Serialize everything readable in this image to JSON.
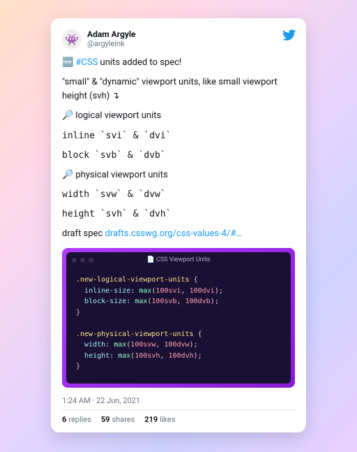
{
  "author": {
    "display_name": "Adam Argyle",
    "handle": "@argyleink",
    "avatar_emoji": "👾"
  },
  "tweet": {
    "line_new_emoji": "🆕",
    "hashtag": "#CSS",
    "line_new_rest": " units added to spec!",
    "line_intro": "\"small\" & \"dynamic\" viewport units, like small viewport height (svh) ↴",
    "section_logical": "🔎 logical viewport units",
    "line_logical_inline": "inline `svi` & `dvi`",
    "line_logical_block": "block `svb` & `dvb`",
    "section_physical": "🔎 physical viewport units",
    "line_physical_width": "width `svw` & `dvw`",
    "line_physical_height": "height `svh` & `dvh`",
    "draft_label": "draft spec ",
    "draft_link": "drafts.csswg.org/css-values-4/#…"
  },
  "code_window": {
    "title": "📄 CSS Viewport Units",
    "code_tokens": [
      [
        [
          "sel",
          ".new-logical-viewport-units"
        ],
        [
          "punct",
          " {"
        ]
      ],
      [
        [
          "punct",
          "  "
        ],
        [
          "prop",
          "inline-size"
        ],
        [
          "punct",
          ": "
        ],
        [
          "func",
          "max"
        ],
        [
          "punct",
          "("
        ],
        [
          "unit",
          "100svi"
        ],
        [
          "punct",
          ", "
        ],
        [
          "unit",
          "100dvi"
        ],
        [
          "punct",
          ");"
        ]
      ],
      [
        [
          "punct",
          "  "
        ],
        [
          "prop",
          "block-size"
        ],
        [
          "punct",
          ": "
        ],
        [
          "func",
          "max"
        ],
        [
          "punct",
          "("
        ],
        [
          "unit",
          "100svb"
        ],
        [
          "punct",
          ", "
        ],
        [
          "unit",
          "100dvb"
        ],
        [
          "punct",
          ");"
        ]
      ],
      [
        [
          "punct",
          "}"
        ]
      ],
      [
        [
          "punct",
          ""
        ]
      ],
      [
        [
          "sel",
          ".new-physical-viewport-units"
        ],
        [
          "punct",
          " {"
        ]
      ],
      [
        [
          "punct",
          "  "
        ],
        [
          "prop",
          "width"
        ],
        [
          "punct",
          ": "
        ],
        [
          "func",
          "max"
        ],
        [
          "punct",
          "("
        ],
        [
          "unit",
          "100svw"
        ],
        [
          "punct",
          ", "
        ],
        [
          "unit",
          "100dvw"
        ],
        [
          "punct",
          ");"
        ]
      ],
      [
        [
          "punct",
          "  "
        ],
        [
          "prop",
          "height"
        ],
        [
          "punct",
          ": "
        ],
        [
          "func",
          "max"
        ],
        [
          "punct",
          "("
        ],
        [
          "unit",
          "100svh"
        ],
        [
          "punct",
          ", "
        ],
        [
          "unit",
          "100dvh"
        ],
        [
          "punct",
          ");"
        ]
      ],
      [
        [
          "punct",
          "}"
        ]
      ]
    ]
  },
  "meta": {
    "time": "1:24 AM",
    "sep": " · ",
    "date": "22 Jun, 2021"
  },
  "stats": {
    "replies_count": "6",
    "replies_label": "replies",
    "shares_count": "59",
    "shares_label": "shares",
    "likes_count": "219",
    "likes_label": "likes"
  }
}
